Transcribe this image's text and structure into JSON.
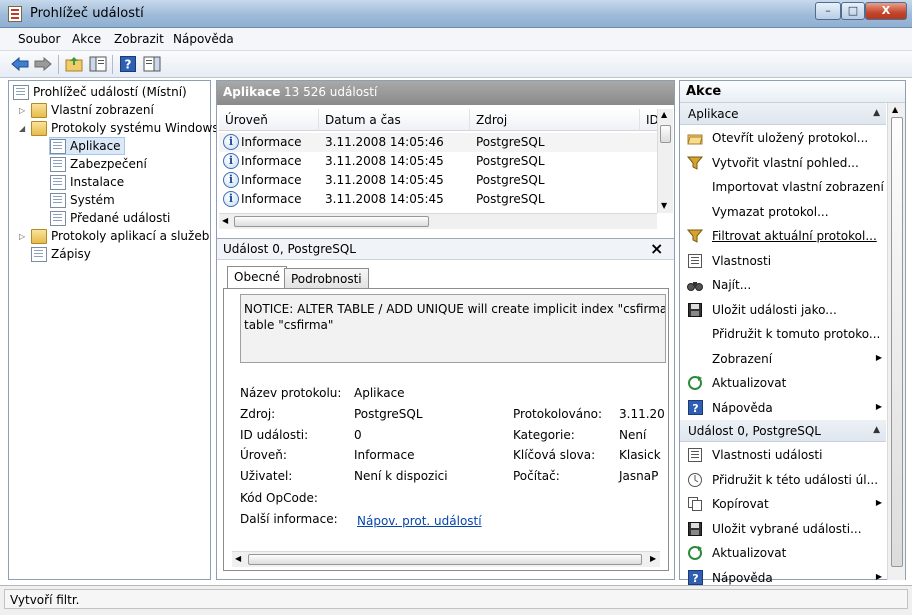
{
  "window": {
    "title": "Prohlížeč událostí"
  },
  "menu": [
    "Soubor",
    "Akce",
    "Zobrazit",
    "Nápověda"
  ],
  "tree": {
    "root": "Prohlížeč událostí (Místní)",
    "custom_views": "Vlastní zobrazení",
    "windows_logs": "Protokoly systému Windows",
    "windows_children": [
      "Aplikace",
      "Zabezpečení",
      "Instalace",
      "Systém",
      "Předané události"
    ],
    "app_service_logs": "Protokoly aplikací a služeb",
    "subscriptions": "Zápisy"
  },
  "list": {
    "title": "Aplikace",
    "count": "13 526 událostí",
    "columns": [
      "Úroveň",
      "Datum a čas",
      "Zdroj",
      "ID"
    ],
    "rows": [
      {
        "level": "Informace",
        "datetime": "3.11.2008 14:05:46",
        "source": "PostgreSQL"
      },
      {
        "level": "Informace",
        "datetime": "3.11.2008 14:05:45",
        "source": "PostgreSQL"
      },
      {
        "level": "Informace",
        "datetime": "3.11.2008 14:05:45",
        "source": "PostgreSQL"
      },
      {
        "level": "Informace",
        "datetime": "3.11.2008 14:05:45",
        "source": "PostgreSQL"
      }
    ]
  },
  "detail": {
    "title": "Událost 0, PostgreSQL",
    "close": "×",
    "tabs": [
      "Obecné",
      "Podrobnosti"
    ],
    "message_line1": "NOTICE:  ALTER TABLE / ADD UNIQUE will create implicit index \"csfirma_dbi",
    "message_line2": "table \"csfirma\"",
    "fields": {
      "log_name_label": "Název protokolu:",
      "log_name": "Aplikace",
      "source_label": "Zdroj:",
      "source": "PostgreSQL",
      "logged_label": "Protokolováno:",
      "logged": "3.11.20",
      "event_id_label": "ID události:",
      "event_id": "0",
      "category_label": "Kategorie:",
      "category": "Není",
      "level_label": "Úroveň:",
      "level": "Informace",
      "keywords_label": "Klíčová slova:",
      "keywords": "Klasick",
      "user_label": "Uživatel:",
      "user": "Není k dispozici",
      "computer_label": "Počítač:",
      "computer": "JasnaP",
      "opcode_label": "Kód OpCode:",
      "more_info_label": "Další informace:",
      "more_info_link": "Nápov. prot. událostí"
    }
  },
  "actions": {
    "title": "Akce",
    "section1": "Aplikace",
    "section1_items": [
      {
        "icon": "open-log-icon",
        "label": "Otevřít uložený protokol..."
      },
      {
        "icon": "filter-icon",
        "label": "Vytvořit vlastní pohled..."
      },
      {
        "icon": "",
        "label": "Importovat vlastní zobrazení"
      },
      {
        "icon": "",
        "label": "Vymazat protokol..."
      },
      {
        "icon": "filter-icon",
        "label": "Filtrovat aktuální protokol..."
      },
      {
        "icon": "properties-icon",
        "label": "Vlastnosti"
      },
      {
        "icon": "binoculars-icon",
        "label": "Najít..."
      },
      {
        "icon": "save-icon",
        "label": "Uložit události jako..."
      },
      {
        "icon": "",
        "label": "Přidružit k tomuto protoko..."
      },
      {
        "icon": "",
        "label": "Zobrazení",
        "submenu": true
      },
      {
        "icon": "refresh-icon",
        "label": "Aktualizovat"
      },
      {
        "icon": "help-icon",
        "label": "Nápověda",
        "submenu": true
      }
    ],
    "section2": "Událost 0, PostgreSQL",
    "section2_items": [
      {
        "icon": "properties-icon",
        "label": "Vlastnosti události"
      },
      {
        "icon": "task-icon",
        "label": "Přidružit k této události úl..."
      },
      {
        "icon": "copy-icon",
        "label": "Kopírovat",
        "submenu": true
      },
      {
        "icon": "save-icon",
        "label": "Uložit vybrané události..."
      },
      {
        "icon": "refresh-icon",
        "label": "Aktualizovat"
      },
      {
        "icon": "help-icon",
        "label": "Nápověda",
        "submenu": true
      }
    ]
  },
  "status": "Vytvoří filtr."
}
